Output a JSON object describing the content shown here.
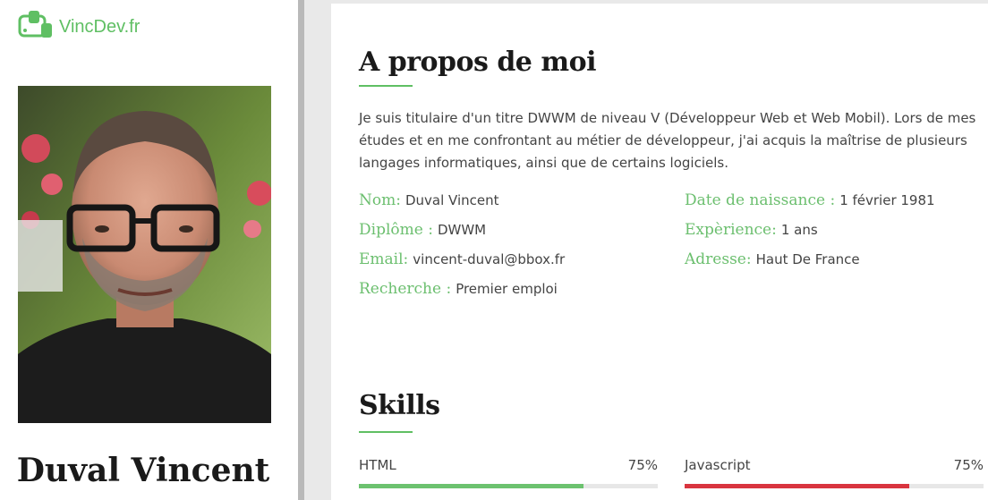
{
  "sidebar": {
    "logo_text": "VincDev.fr",
    "name": "Duval Vincent"
  },
  "about": {
    "title": "A propos de moi",
    "text": "Je suis titulaire d'un titre DWWM de niveau V (Développeur Web et Web Mobil). Lors de mes études et en me confrontant au métier de développeur, j'ai acquis la maîtrise de plusieurs langages informatiques, ainsi que de certains logiciels.",
    "info_left": [
      {
        "label": "Nom:",
        "value": "Duval Vincent"
      },
      {
        "label": "Diplôme :",
        "value": "DWWM"
      },
      {
        "label": "Email:",
        "value": "vincent-duval@bbox.fr"
      },
      {
        "label": "Recherche :",
        "value": "Premier emploi"
      }
    ],
    "info_right": [
      {
        "label": "Date de naissance :",
        "value": "1 février 1981"
      },
      {
        "label": "Expèrience:",
        "value": "1 ans"
      },
      {
        "label": "Adresse:",
        "value": "Haut De France"
      }
    ]
  },
  "skills": {
    "title": "Skills",
    "items": [
      {
        "name": "HTML",
        "percent_label": "75%",
        "level": 0.75,
        "color": "#6cc26f"
      },
      {
        "name": "Javascript",
        "percent_label": "75%",
        "level": 0.75,
        "color": "#d9343f"
      }
    ]
  },
  "icons": {
    "logo": "device-brand-icon"
  }
}
